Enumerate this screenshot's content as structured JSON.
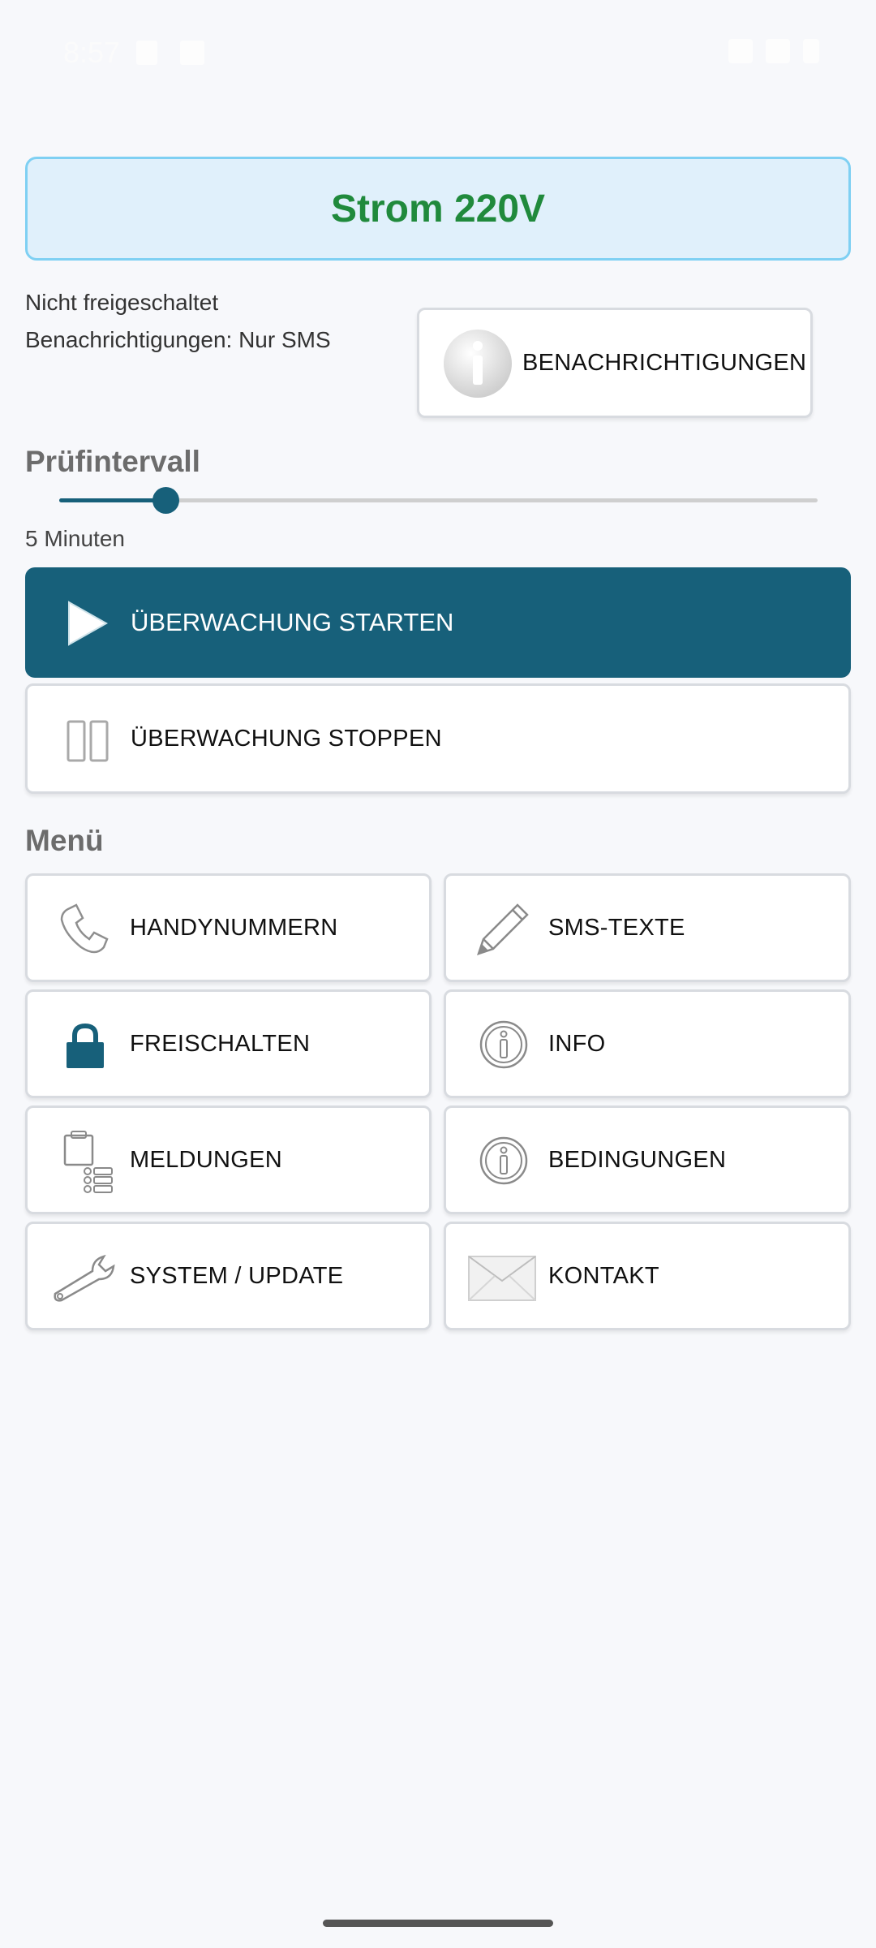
{
  "status_bar": {
    "time": "8:57"
  },
  "header": {
    "title": "Strom 220V"
  },
  "status": {
    "activation": "Nicht freigeschaltet",
    "notifications": "Benachrichtigungen: Nur SMS"
  },
  "notify_button": {
    "label": "BENACHRICHTIGUNGEN",
    "icon": "info-icon"
  },
  "interval": {
    "heading": "Prüfintervall",
    "value_label": "5 Minuten",
    "slider_fraction": 0.14
  },
  "actions": {
    "start_label": "ÜBERWACHUNG STARTEN",
    "stop_label": "ÜBERWACHUNG STOPPEN"
  },
  "menu": {
    "heading": "Menü",
    "items": [
      {
        "label": "HANDYNUMMERN",
        "icon": "phone-icon"
      },
      {
        "label": "SMS-TEXTE",
        "icon": "pencil-icon"
      },
      {
        "label": "FREISCHALTEN",
        "icon": "lock-icon"
      },
      {
        "label": "INFO",
        "icon": "info-icon"
      },
      {
        "label": "MELDUNGEN",
        "icon": "clipboard-list-icon"
      },
      {
        "label": "BEDINGUNGEN",
        "icon": "info-icon"
      },
      {
        "label": "SYSTEM / UPDATE",
        "icon": "wrench-icon"
      },
      {
        "label": "KONTAKT",
        "icon": "envelope-icon"
      }
    ]
  },
  "colors": {
    "accent": "#17607a",
    "title_green": "#208a3c",
    "title_bg": "#e0f0fb",
    "title_border": "#7fd0f3"
  }
}
